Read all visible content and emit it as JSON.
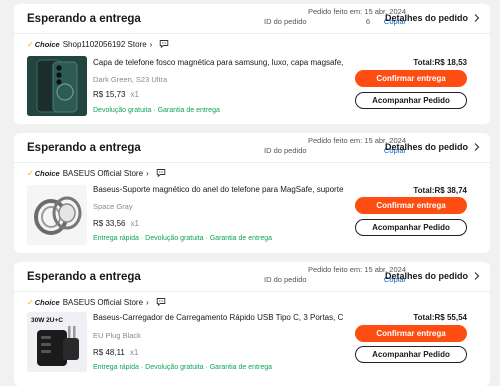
{
  "orders": [
    {
      "status": "Esperando a entrega",
      "date": "Pedido feito em: 15 abr, 2024",
      "id_label": "ID do pedido",
      "id_number": "6",
      "copy_label": "Copiar",
      "details_label": "Detalhes do pedido",
      "choice_label": "Choice",
      "store_name": "Shop1102056192 Store",
      "store_arrow": "›",
      "product_name": "Capa de telefone fosco magnética para samsung, luxo, capa magsafe, s...",
      "variant": "Dark Green, S23 Ultra",
      "price": "R$ 15,73",
      "qty": "x1",
      "tags": "Devolução gratuita · Garantia de entrega",
      "total": "Total:R$ 18,53",
      "confirm_label": "Confirmar entrega",
      "track_label": "Acompanhar Pedido"
    },
    {
      "status": "Esperando a entrega",
      "date": "Pedido feito em: 15 abr, 2024",
      "id_label": "ID do pedido",
      "id_number": "",
      "copy_label": "Copiar",
      "details_label": "Detalhes do pedido",
      "choice_label": "Choice",
      "store_name": "BASEUS Official Store",
      "store_arrow": "›",
      "product_name": "Baseus-Suporte magnético do anel do telefone para MagSafe, suporte ...",
      "variant": "Space Gray",
      "price": "R$ 33,56",
      "qty": "x1",
      "tags": "Entrega rápida · Devolução gratuita · Garantia de entrega",
      "total": "Total:R$ 38,74",
      "confirm_label": "Confirmar entrega",
      "track_label": "Acompanhar Pedido"
    },
    {
      "status": "Esperando a entrega",
      "date": "Pedido feito em: 15 abr, 2024",
      "id_label": "ID do pedido",
      "id_number": "",
      "copy_label": "Copiar",
      "details_label": "Detalhes do pedido",
      "choice_label": "Choice",
      "store_name": "BASEUS Official Store",
      "store_arrow": "›",
      "product_name": "Baseus-Carregador de Carregamento Rápido USB Tipo C, 3 Portas, Carr...",
      "variant": "EU Plug Black",
      "price": "R$ 48,11",
      "qty": "x1",
      "tags": "Entrega rápida · Devolução gratuita · Garantia de entrega",
      "total": "Total:R$ 55,54",
      "confirm_label": "Confirmar entrega",
      "track_label": "Acompanhar Pedido"
    }
  ],
  "product_images": [
    "phone-case-image",
    "magnetic-ring-holder-image",
    "usb-c-charger-image"
  ],
  "charger_badge": "30W 2U+C",
  "colors": {
    "accent": "#fd4d13",
    "link": "#0a66d6",
    "tag_green": "#10a35a",
    "choice_gold": "#f5a623"
  }
}
